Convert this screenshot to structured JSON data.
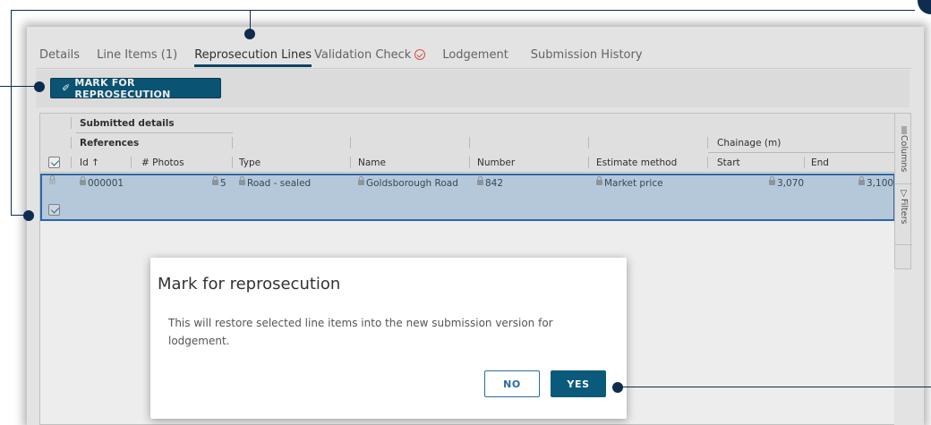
{
  "tabs": [
    {
      "label": "Details",
      "active": false
    },
    {
      "label": "Line Items (1)",
      "active": false
    },
    {
      "label": "Reprosecution Lines",
      "active": true
    },
    {
      "label": "Validation Check",
      "active": false,
      "icon": "check-circle-icon"
    },
    {
      "label": "Lodgement",
      "active": false
    },
    {
      "label": "Submission History",
      "active": false
    }
  ],
  "toolbar": {
    "mark_button_label": "MARK FOR REPROSECUTION",
    "mark_button_icon": "marker-icon"
  },
  "grid": {
    "group_headers": {
      "submitted_details": "Submitted details",
      "references": "References",
      "chainage": "Chainage (m)"
    },
    "columns": [
      {
        "label": "Id",
        "sort": "ascending",
        "sort_symbol": "↑"
      },
      {
        "label": "# Photos"
      },
      {
        "label": "Type"
      },
      {
        "label": "Name"
      },
      {
        "label": "Number"
      },
      {
        "label": "Estimate method"
      },
      {
        "label": "Start"
      },
      {
        "label": "End"
      }
    ],
    "rows": [
      {
        "selected": true,
        "id": "000001",
        "photos": "5",
        "type": "Road - sealed",
        "name": "Goldsborough Road",
        "number": "842",
        "estimate_method": "Market price",
        "start": "3,070",
        "end": "3,100"
      }
    ],
    "side_panel": {
      "columns_label": "Columns",
      "filters_label": "Filters"
    }
  },
  "dialog": {
    "title": "Mark for reprosecution",
    "message": "This will restore selected line items into the new submission version for lodgement.",
    "no_label": "NO",
    "yes_label": "YES"
  },
  "colors": {
    "accent": "#0b5a7c",
    "selection": "#c2d8eb",
    "selection_border": "#2e6fb0",
    "annotation": "#0e2c4e",
    "error": "#e0554a"
  }
}
